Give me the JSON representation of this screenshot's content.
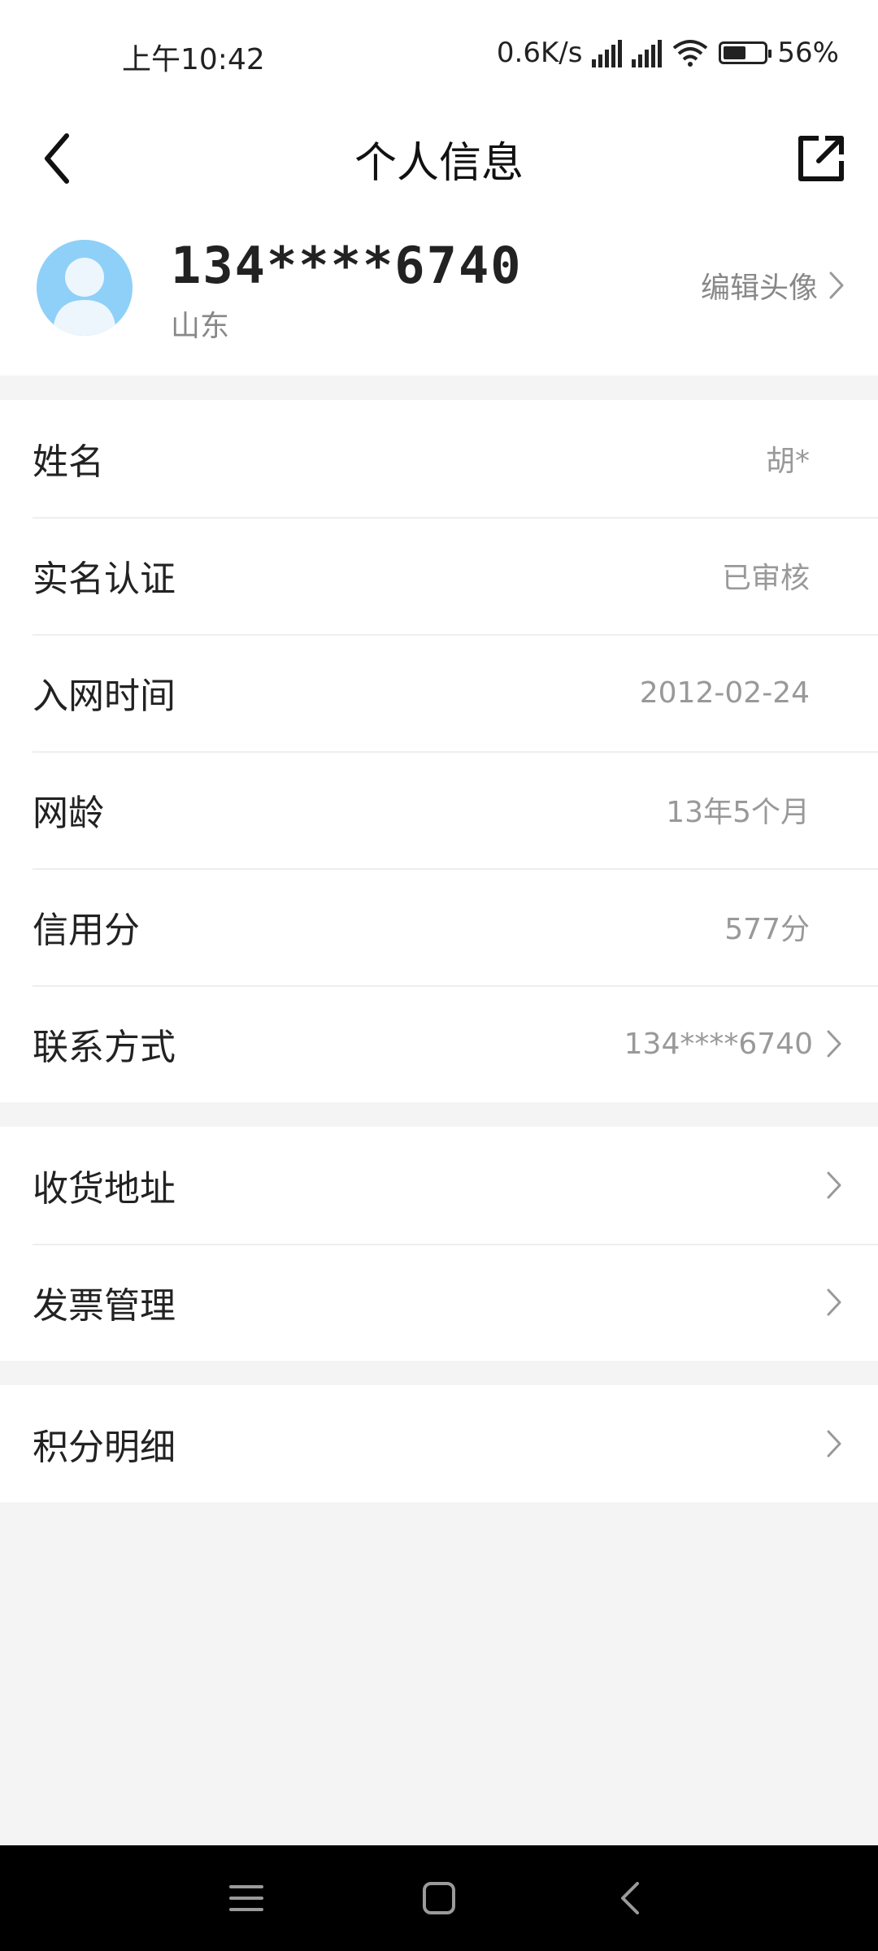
{
  "status_bar": {
    "time": "上午10:42",
    "network_speed": "0.6K/s",
    "battery_percent_label": "56%",
    "battery_level": 0.56,
    "icons": [
      "hd-signal-icon",
      "hd-signal-icon",
      "wifi-6-icon",
      "battery-icon"
    ]
  },
  "header": {
    "title": "个人信息",
    "back_icon": "chevron-left-icon",
    "share_icon": "share-external-icon"
  },
  "profile": {
    "phone": "134****6740",
    "province": "山东",
    "edit_avatar_label": "编辑头像"
  },
  "info_section": {
    "rows": [
      {
        "label": "姓名",
        "value": "胡*"
      },
      {
        "label": "实名认证",
        "value": "已审核"
      },
      {
        "label": "入网时间",
        "value": "2012-02-24"
      },
      {
        "label": "网龄",
        "value": "13年5个月"
      },
      {
        "label": "信用分",
        "value": "577分"
      },
      {
        "label": "联系方式",
        "value": "134****6740"
      }
    ]
  },
  "address_section": {
    "rows": [
      {
        "label": "收货地址"
      },
      {
        "label": "发票管理"
      }
    ]
  },
  "points_section": {
    "rows": [
      {
        "label": "积分明细"
      }
    ]
  },
  "nav_bar": {
    "icons": [
      "menu-icon",
      "home-icon",
      "back-icon"
    ]
  }
}
